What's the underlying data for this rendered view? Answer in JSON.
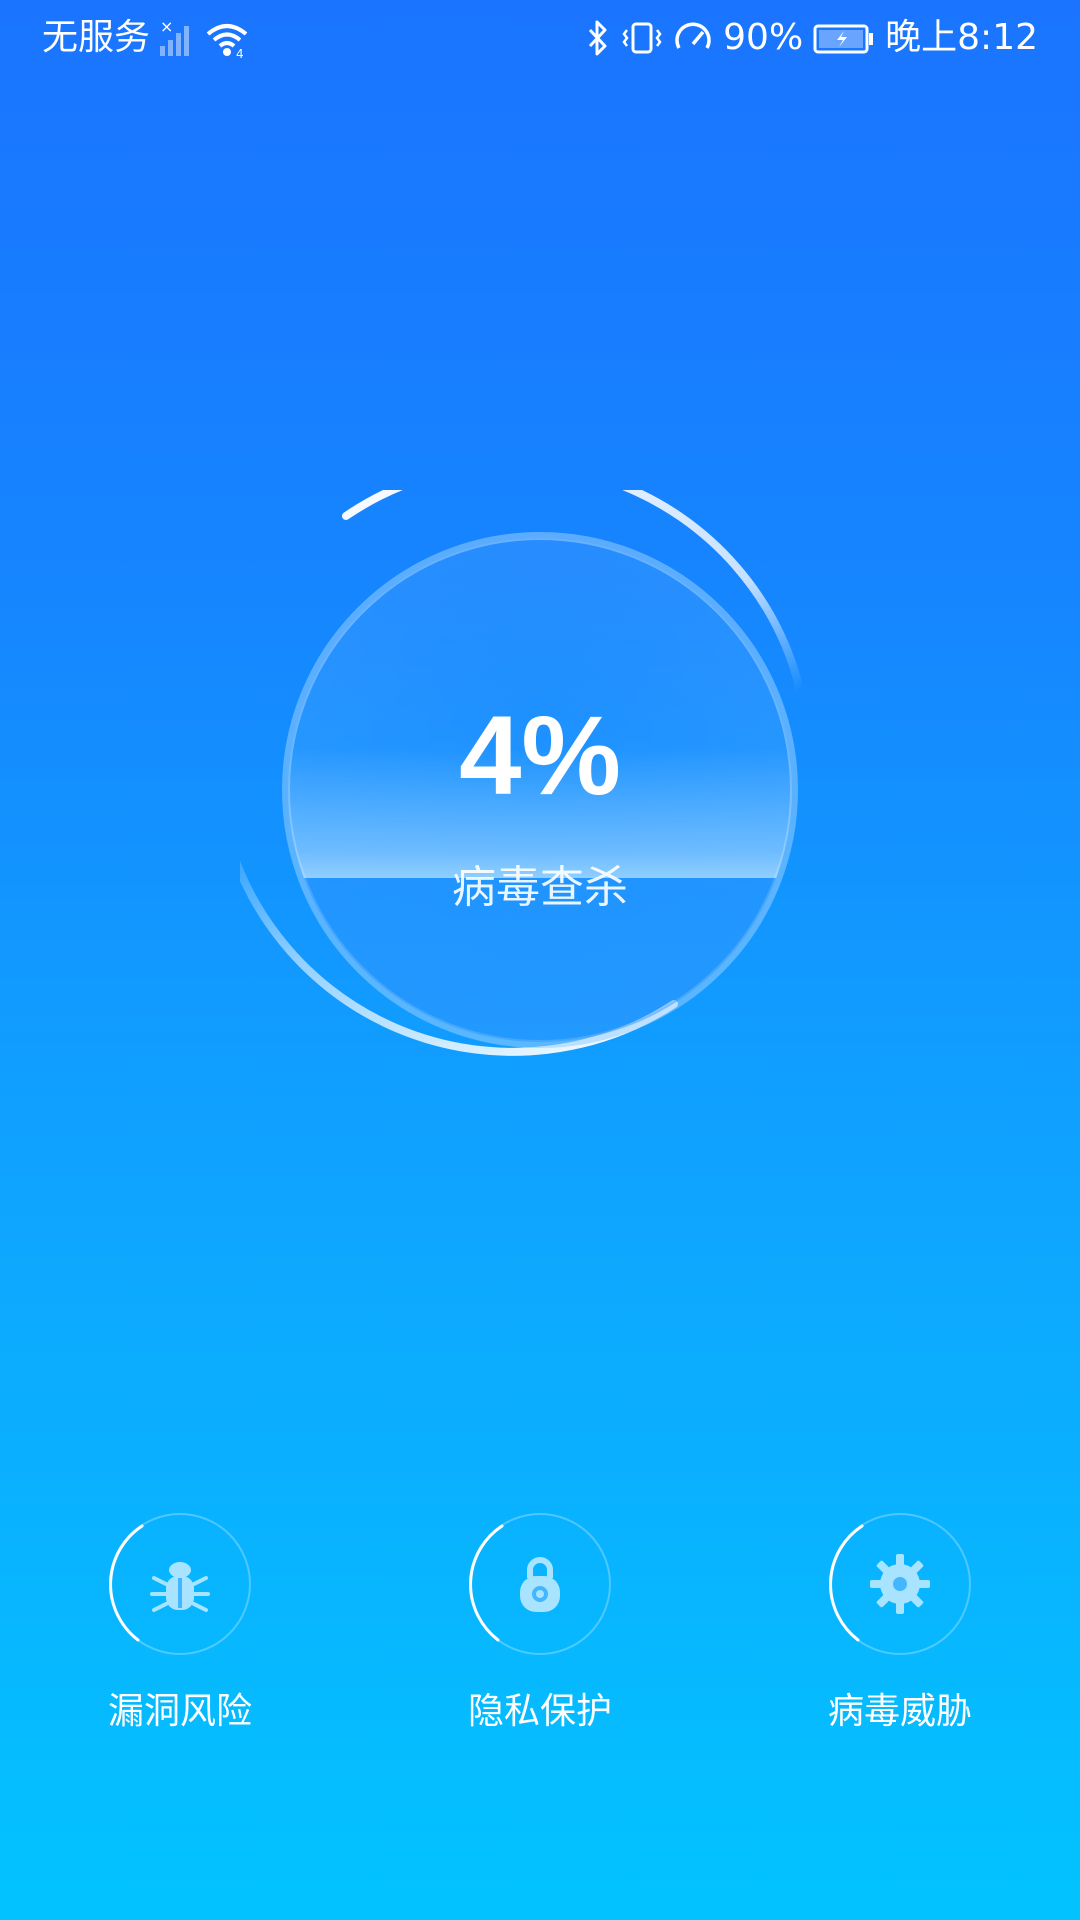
{
  "status_bar": {
    "carrier": "无服务",
    "battery_percent": "90%",
    "time": "晚上8:12",
    "icons": [
      "no-signal-icon",
      "wifi-icon",
      "bluetooth-icon",
      "vibrate-icon",
      "speedometer-icon",
      "battery-charging-icon"
    ]
  },
  "scan": {
    "percent": "4%",
    "progress": 0.04,
    "label": "病毒查杀"
  },
  "features": [
    {
      "label": "漏洞风险",
      "icon": "bug-icon"
    },
    {
      "label": "隐私保护",
      "icon": "lock-icon"
    },
    {
      "label": "病毒威胁",
      "icon": "gear-icon"
    }
  ],
  "colors": {
    "background_top": "#1a74ff",
    "background_bottom": "#02c3ff",
    "icon_fill": "#a8e4ff"
  }
}
